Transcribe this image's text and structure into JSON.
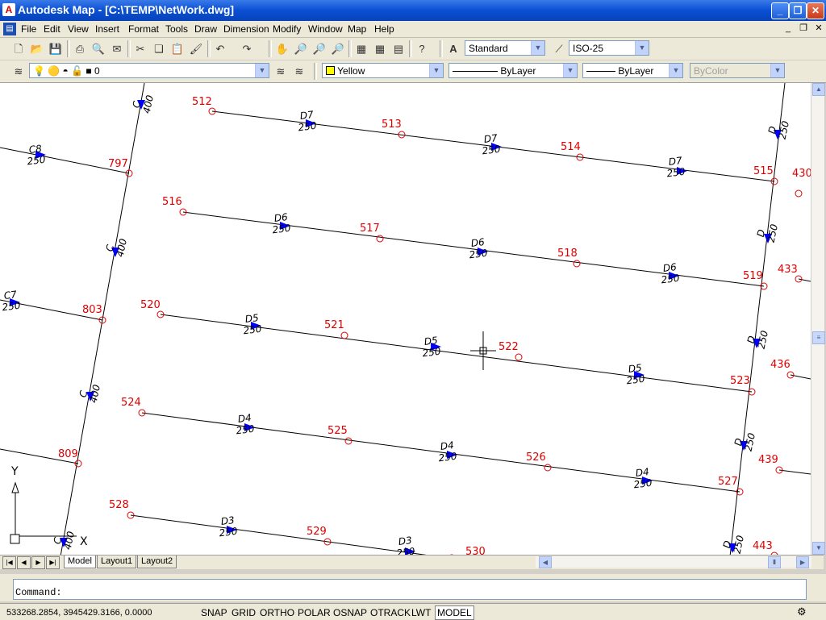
{
  "window": {
    "title": "Autodesk Map - [C:\\TEMP\\NetWork.dwg]"
  },
  "menu": [
    "File",
    "Edit",
    "View",
    "Insert",
    "Format",
    "Tools",
    "Draw",
    "Dimension",
    "Modify",
    "Window",
    "Map",
    "Help"
  ],
  "toolbar": {
    "text_style": "Standard",
    "dim_style": "ISO-25",
    "layer": "0",
    "color": "Yellow",
    "linetype": "ByLayer",
    "lineweight": "ByLayer",
    "plotstyle": "ByColor"
  },
  "drawing": {
    "nodes": [
      "512",
      "513",
      "514",
      "515",
      "516",
      "517",
      "518",
      "519",
      "520",
      "521",
      "522",
      "523",
      "524",
      "525",
      "526",
      "527",
      "528",
      "529",
      "530",
      "797",
      "803",
      "809",
      "430",
      "433",
      "436",
      "439",
      "443"
    ],
    "pipe_labels": [
      {
        "id": "D7",
        "size": "250"
      },
      {
        "id": "D7",
        "size": "250"
      },
      {
        "id": "D7",
        "size": "250"
      },
      {
        "id": "D6",
        "size": "250"
      },
      {
        "id": "D6",
        "size": "250"
      },
      {
        "id": "D6",
        "size": "250"
      },
      {
        "id": "D5",
        "size": "250"
      },
      {
        "id": "D5",
        "size": "250"
      },
      {
        "id": "D5",
        "size": "250"
      },
      {
        "id": "D4",
        "size": "250"
      },
      {
        "id": "D4",
        "size": "250"
      },
      {
        "id": "D4",
        "size": "250"
      },
      {
        "id": "D3",
        "size": "250"
      },
      {
        "id": "D3",
        "size": "250"
      },
      {
        "id": "C8",
        "size": "250"
      },
      {
        "id": "C7",
        "size": "250"
      },
      {
        "id": "C",
        "size": "400"
      },
      {
        "id": "C",
        "size": "400"
      },
      {
        "id": "C",
        "size": "400"
      },
      {
        "id": "C",
        "size": "400"
      },
      {
        "id": "D",
        "size": "250"
      },
      {
        "id": "D",
        "size": "250"
      },
      {
        "id": "D",
        "size": "250"
      },
      {
        "id": "D",
        "size": "250"
      },
      {
        "id": "D",
        "size": "250"
      }
    ],
    "ucs_x": "X",
    "ucs_y": "Y"
  },
  "tabs": [
    "Model",
    "Layout1",
    "Layout2"
  ],
  "command": {
    "prompt": "Command:"
  },
  "status": {
    "coords": "533268.2854, 3945429.3166, 0.0000",
    "toggles": [
      "SNAP",
      "GRID",
      "ORTHO",
      "POLAR",
      "OSNAP",
      "OTRACK",
      "LWT",
      "MODEL"
    ]
  },
  "colors": {
    "node": "#e00000",
    "arrow": "#0000ff",
    "titlebar": "#0a4fd4"
  },
  "icons": [
    "app-icon",
    "minimize-icon",
    "maximize-icon",
    "close-icon",
    "new-icon",
    "open-icon",
    "save-icon",
    "print-icon",
    "preview-icon",
    "cut-icon",
    "copy-icon",
    "paste-icon",
    "matchprop-icon",
    "undo-icon",
    "redo-icon",
    "pan-icon",
    "zoom-icon",
    "help-icon"
  ]
}
